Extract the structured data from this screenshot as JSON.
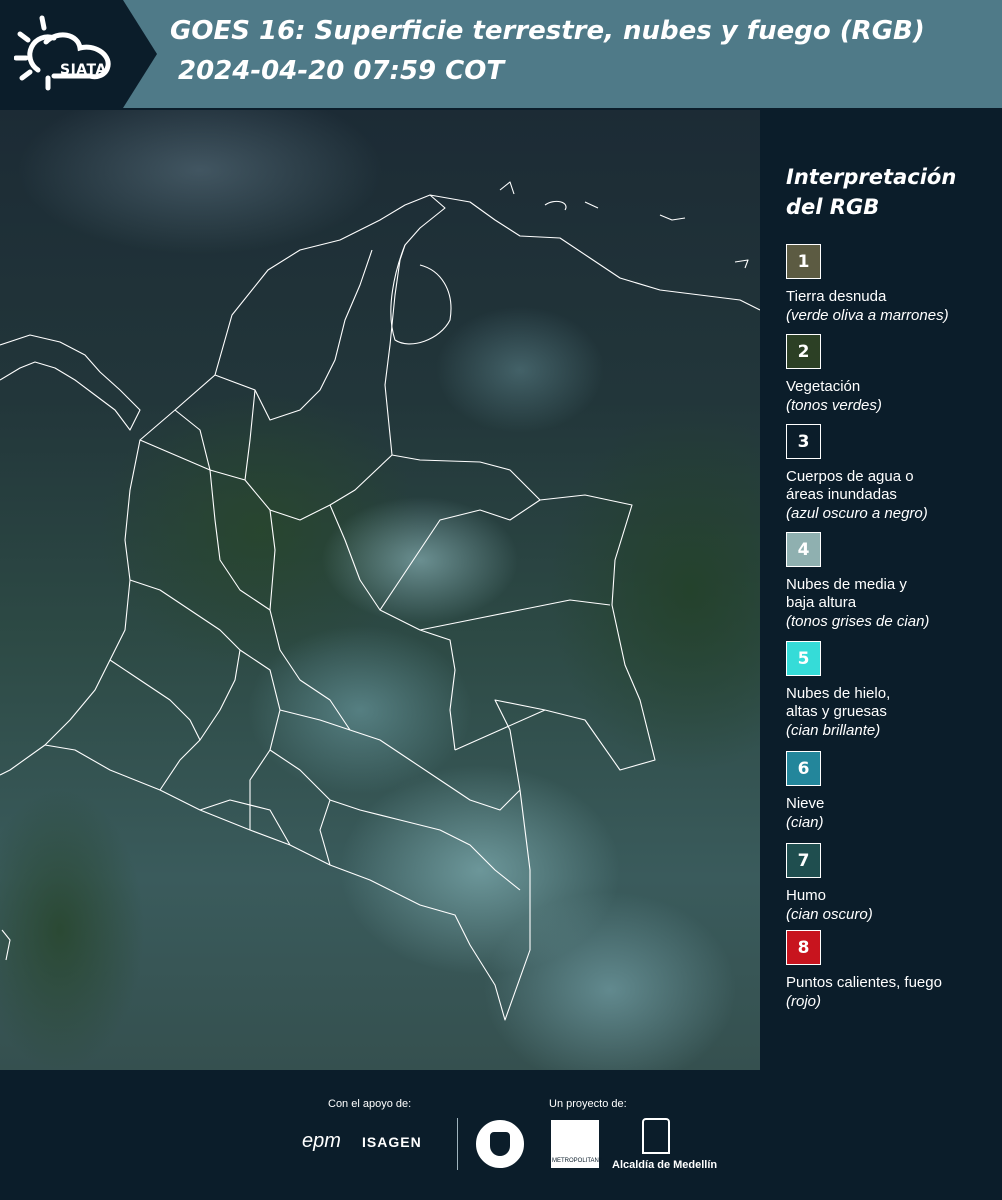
{
  "header": {
    "logo_text": "SIATA",
    "title_line1": "GOES 16: Superficie terrestre, nubes y fuego (RGB)",
    "title_line2": "2024-04-20 07:59 COT"
  },
  "colors": {
    "header_band": "#4f7a88",
    "background": "#0b1d2a",
    "borders": "#ffffff"
  },
  "legend": {
    "title_line1": "Interpretación",
    "title_line2": "del RGB",
    "items": [
      {
        "number": "1",
        "color": "#5c5b42",
        "label": "Tierra desnuda",
        "sub": "(verde oliva a marrones)"
      },
      {
        "number": "2",
        "color": "#2c4025",
        "label": "Vegetación",
        "sub": "(tonos verdes)"
      },
      {
        "number": "3",
        "color": "#0b1d2a",
        "label": "Cuerpos de agua o áreas inundadas",
        "sub": "(azul oscuro a negro)"
      },
      {
        "number": "4",
        "color": "#8fb0b0",
        "label": "Nubes de media y baja altura",
        "sub": "(tonos grises de cian)"
      },
      {
        "number": "5",
        "color": "#35dcd8",
        "label": "Nubes de hielo, altas y gruesas",
        "sub": "(cian brillante)"
      },
      {
        "number": "6",
        "color": "#23869b",
        "label": "Nieve",
        "sub": "(cian)"
      },
      {
        "number": "7",
        "color": "#1f4e4f",
        "label": "Humo",
        "sub": "(cian oscuro)"
      },
      {
        "number": "8",
        "color": "#c8141e",
        "label": "Puntos calientes, fuego",
        "sub": "(rojo)"
      }
    ]
  },
  "footer": {
    "support_label": "Con el apoyo de:",
    "project_label": "Un proyecto de:",
    "sponsors": [
      "epm",
      "ISAGEN"
    ],
    "area_metropolitana": "METROPOLITANA",
    "alcaldia": "Alcaldía de Medellín"
  }
}
